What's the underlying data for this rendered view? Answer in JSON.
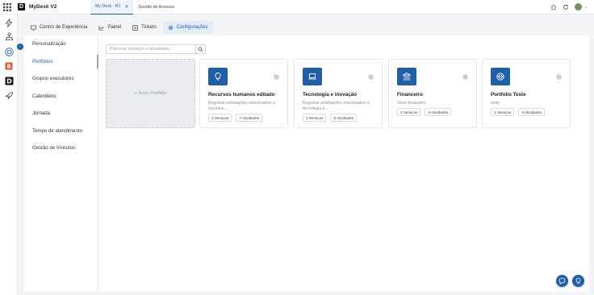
{
  "app": {
    "name": "MyDesk V2"
  },
  "tabs": [
    {
      "label": "My Desk - R1",
      "active": true,
      "closable": true
    },
    {
      "label": "Gestão de Acessos",
      "active": false
    }
  ],
  "topbar_icons": [
    "home-icon",
    "refresh-icon",
    "user-avatar",
    "chevron-down-icon"
  ],
  "rail_icons": [
    "lightning-icon",
    "people-tree-icon",
    "portfolio-badge-icon",
    "b-app-icon",
    "d-app-icon",
    "rocket-icon"
  ],
  "nav": {
    "items": [
      {
        "label": "Centro de Experiência",
        "icon": "monitor-icon"
      },
      {
        "label": "Painel",
        "icon": "chart-icon"
      },
      {
        "label": "Tickets",
        "icon": "ticket-icon"
      },
      {
        "label": "Configurações",
        "icon": "gear-icon",
        "active": true
      }
    ]
  },
  "sidemenu": {
    "items": [
      {
        "label": "Personalização"
      },
      {
        "label": "Portfolios",
        "active": true
      },
      {
        "label": "Grupos executores"
      },
      {
        "label": "Calendário"
      },
      {
        "label": "Jornada"
      },
      {
        "label": "Tempo de atendimento"
      },
      {
        "label": "Gestão de Vínculos"
      }
    ]
  },
  "search": {
    "placeholder": "Procurar serviços e atividades..."
  },
  "new_portfolio": {
    "label": "+ Novo Portfólio"
  },
  "cards": [
    {
      "title": "Recursos humanos editado",
      "description": "Registrar solicitações relacionados a recursos...",
      "services": "3 Serviços",
      "activities": "7 Atividades",
      "icon": "lightbulb-icon"
    },
    {
      "title": "Tecnologia e inovação",
      "description": "Registrar solicitações relacionados a tecnologia e...",
      "services": "3 Serviços",
      "activities": "8 Atividades",
      "icon": "laptop-icon"
    },
    {
      "title": "Financeiro",
      "description": "Setor financeiro",
      "services": "3 Serviços",
      "activities": "5 Atividades",
      "icon": "bank-icon"
    },
    {
      "title": "Portfolio Teste",
      "description": "teste",
      "services": "1 Serviços",
      "activities": "0 Atividades",
      "icon": "globe-icon"
    }
  ],
  "colors": {
    "accent": "#1f5fa8",
    "background": "#f3f4f6",
    "card_border": "#e6e8eb"
  }
}
